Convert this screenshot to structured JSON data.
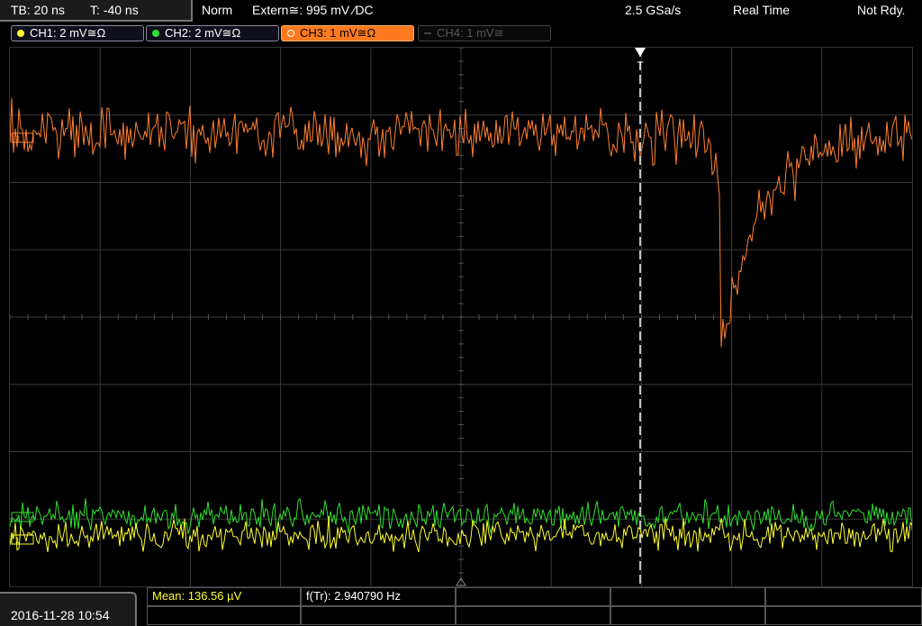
{
  "topbar": {
    "tb": "TB: 20 ns",
    "t": "T: -40 ns",
    "mode": "Norm",
    "trigger": "Extern≅: 995 mV ⁄DC",
    "sample_rate": "2.5 GSa/s",
    "acq": "Real Time",
    "status": "Not Rdy."
  },
  "channels": [
    {
      "label": "CH1: 2 mV≅Ω",
      "color": "#ffff30"
    },
    {
      "label": "CH2: 2 mV≅Ω",
      "color": "#30e030"
    },
    {
      "label": "CH3: 1 mV≅Ω",
      "color": "#ff7a1e"
    },
    {
      "label": "CH4: 1 mV≅",
      "color": "#555555"
    }
  ],
  "markers": {
    "ch3": "3",
    "ch2": "2",
    "ch1": "1",
    "trigger": "T"
  },
  "measurements": {
    "mean": "Mean: 136.56 µV",
    "freq": "f(Tr): 2.940790 Hz"
  },
  "datetime": "2016-11-28 10:54",
  "colors": {
    "ch1": "#ffff30",
    "ch2": "#30e030",
    "ch3": "#ff8030",
    "grid": "#3a3a3a"
  }
}
